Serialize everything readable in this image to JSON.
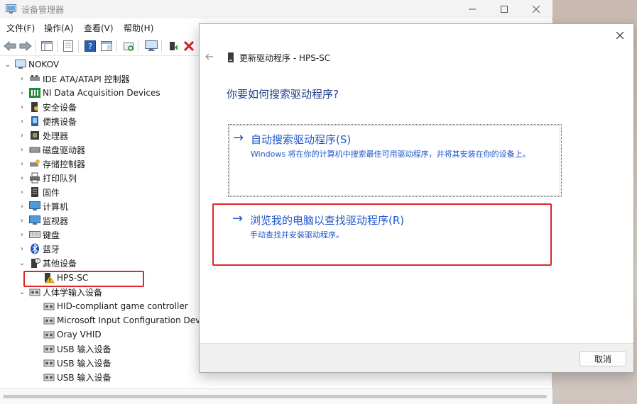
{
  "window": {
    "title": "设备管理器",
    "controls": {
      "minimize": "—",
      "maximize": "☐",
      "close": "✕"
    }
  },
  "menu": [
    "文件(F)",
    "操作(A)",
    "查看(V)",
    "帮助(H)"
  ],
  "tree": {
    "root": "NOKOV",
    "items": [
      {
        "label": "IDE ATA/ATAPI 控制器",
        "icon": "ide-controller-icon"
      },
      {
        "label": "NI Data Acquisition Devices",
        "icon": "ni-daq-icon"
      },
      {
        "label": "安全设备",
        "icon": "security-device-icon"
      },
      {
        "label": "便携设备",
        "icon": "portable-device-icon"
      },
      {
        "label": "处理器",
        "icon": "processor-icon"
      },
      {
        "label": "磁盘驱动器",
        "icon": "disk-drive-icon"
      },
      {
        "label": "存储控制器",
        "icon": "storage-controller-icon"
      },
      {
        "label": "打印队列",
        "icon": "print-queue-icon"
      },
      {
        "label": "固件",
        "icon": "firmware-icon"
      },
      {
        "label": "计算机",
        "icon": "computer-icon"
      },
      {
        "label": "监视器",
        "icon": "monitor-icon"
      },
      {
        "label": "键盘",
        "icon": "keyboard-icon"
      },
      {
        "label": "蓝牙",
        "icon": "bluetooth-icon"
      },
      {
        "label": "其他设备",
        "icon": "other-devices-icon"
      }
    ],
    "other_child": "HPS-SC",
    "hid_group": "人体学输入设备",
    "hid_children": [
      "HID-compliant game controller",
      "Microsoft Input Configuration Device",
      "Oray VHID",
      "USB 输入设备",
      "USB 输入设备",
      "USB 输入设备"
    ]
  },
  "dialog": {
    "title": "更新驱动程序 - HPS-SC",
    "question": "你要如何搜索驱动程序?",
    "option1": {
      "title": "自动搜索驱动程序(S)",
      "desc": "Windows 将在你的计算机中搜索最佳可用驱动程序，并将其安装在你的设备上。"
    },
    "option2": {
      "title": "浏览我的电脑以查找驱动程序(R)",
      "desc": "手动查找并安装驱动程序。"
    },
    "cancel": "取消"
  },
  "colors": {
    "link_blue": "#1f57c8",
    "question_blue": "#1f3f8a",
    "highlight_red": "#e0262a"
  }
}
